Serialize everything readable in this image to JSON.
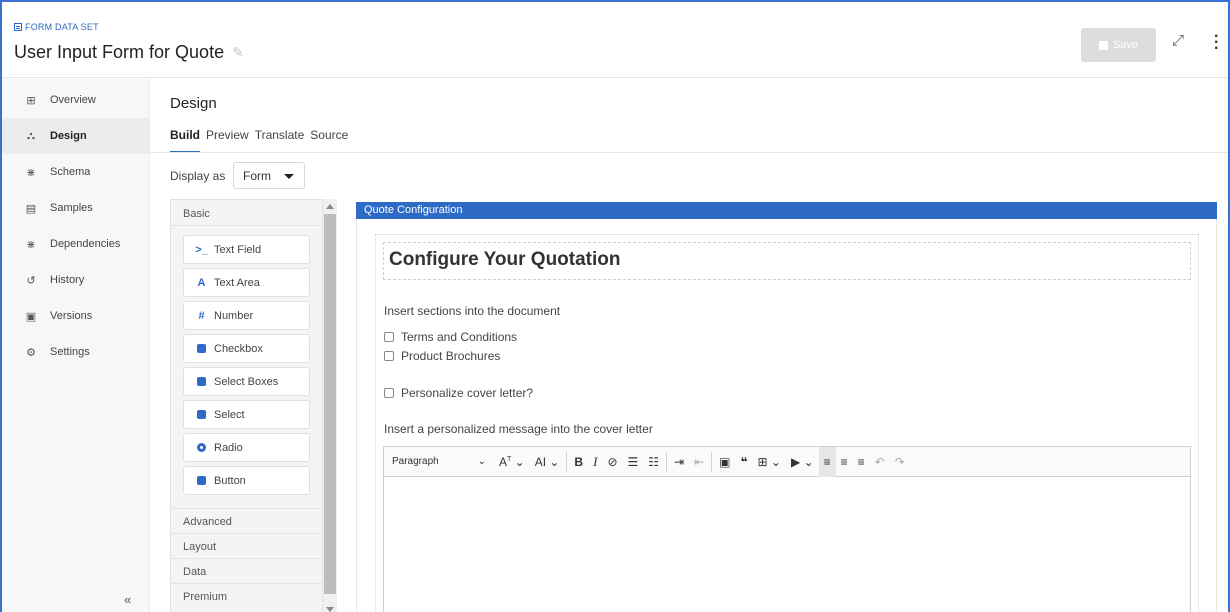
{
  "header": {
    "breadcrumb": "FORM DATA SET",
    "title": "User Input Form for Quote",
    "save_label": "Save"
  },
  "sidebar": {
    "items": [
      {
        "label": "Overview",
        "icon": "grid-icon"
      },
      {
        "label": "Design",
        "icon": "design-icon"
      },
      {
        "label": "Schema",
        "icon": "schema-icon"
      },
      {
        "label": "Samples",
        "icon": "document-icon"
      },
      {
        "label": "Dependencies",
        "icon": "dependencies-icon"
      },
      {
        "label": "History",
        "icon": "history-icon"
      },
      {
        "label": "Versions",
        "icon": "versions-icon"
      },
      {
        "label": "Settings",
        "icon": "gear-icon"
      }
    ],
    "active": "Design"
  },
  "main": {
    "title": "Design",
    "tabs": [
      "Build",
      "Preview",
      "Translate",
      "Source"
    ],
    "active_tab": "Build",
    "display_as_label": "Display as",
    "display_as_value": "Form"
  },
  "palette": {
    "header": "Basic",
    "buttons": [
      {
        "label": "Text Field",
        "icon": "terminal-icon"
      },
      {
        "label": "Text Area",
        "icon": "font-icon"
      },
      {
        "label": "Number",
        "icon": "hash-icon"
      },
      {
        "label": "Checkbox",
        "icon": "checkbox-icon"
      },
      {
        "label": "Select Boxes",
        "icon": "plus-square-icon"
      },
      {
        "label": "Select",
        "icon": "list-icon"
      },
      {
        "label": "Radio",
        "icon": "radio-icon"
      },
      {
        "label": "Button",
        "icon": "stop-icon"
      }
    ],
    "sections": [
      "Advanced",
      "Layout",
      "Data",
      "Premium"
    ]
  },
  "canvas": {
    "panel_title": "Quote Configuration",
    "heading": "Configure Your Quotation",
    "sections_label": "Insert sections into the document",
    "checkboxes": [
      "Terms and Conditions",
      "Product Brochures"
    ],
    "personalize_label": "Personalize cover letter?",
    "message_label": "Insert a personalized message into the cover letter",
    "editor_paragraph": "Paragraph"
  },
  "colors": {
    "accent": "#2e6bc6",
    "save_disabled": "#dddddd"
  }
}
